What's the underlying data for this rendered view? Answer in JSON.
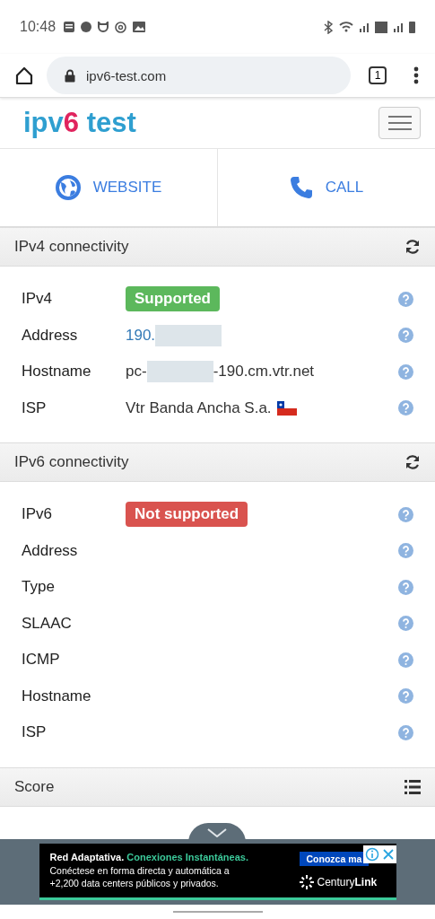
{
  "status_bar": {
    "time": "10:48"
  },
  "browser": {
    "url": "ipv6-test.com",
    "tab_count": "1"
  },
  "site": {
    "logo_parts": [
      {
        "text": "ipv",
        "color": "#2f9fd0"
      },
      {
        "text": "6",
        "color": "#e0245e"
      },
      {
        "text": " test",
        "color": "#2f9fd0"
      }
    ]
  },
  "actions": [
    {
      "kind": "globe",
      "label": "WEBSITE"
    },
    {
      "kind": "phone",
      "label": "CALL"
    }
  ],
  "sections": [
    {
      "title": "IPv4 connectivity",
      "kind": "refresh",
      "rows": [
        {
          "label": "IPv4",
          "kind": "badge",
          "supported": true,
          "value": "Supported"
        },
        {
          "label": "Address",
          "kind": "link",
          "value": "190.",
          "redacted": true
        },
        {
          "label": "Hostname",
          "kind": "text",
          "value": "pc-",
          "redacted": true,
          "value_after": "-190.cm.vtr.net"
        },
        {
          "label": "ISP",
          "kind": "text",
          "value": "Vtr Banda Ancha S.a.",
          "flag": true
        }
      ]
    },
    {
      "title": "IPv6 connectivity",
      "kind": "refresh",
      "rows": [
        {
          "label": "IPv6",
          "kind": "badge",
          "supported": false,
          "value": "Not supported"
        },
        {
          "label": "Address",
          "kind": "empty"
        },
        {
          "label": "Type",
          "kind": "empty"
        },
        {
          "label": "SLAAC",
          "kind": "empty"
        },
        {
          "label": "ICMP",
          "kind": "empty"
        },
        {
          "label": "Hostname",
          "kind": "empty"
        },
        {
          "label": "ISP",
          "kind": "empty"
        }
      ]
    },
    {
      "title": "Score",
      "kind": "list"
    }
  ],
  "ad": {
    "headline": "Red Adaptativa.",
    "headline_accent": "Conexiones Instantáneas.",
    "body": "Conéctese en forma directa y automática a +2,200 data centers públicos y privados.",
    "button": "Conozca ma",
    "brand": "Century",
    "brand_bold": "Link"
  }
}
